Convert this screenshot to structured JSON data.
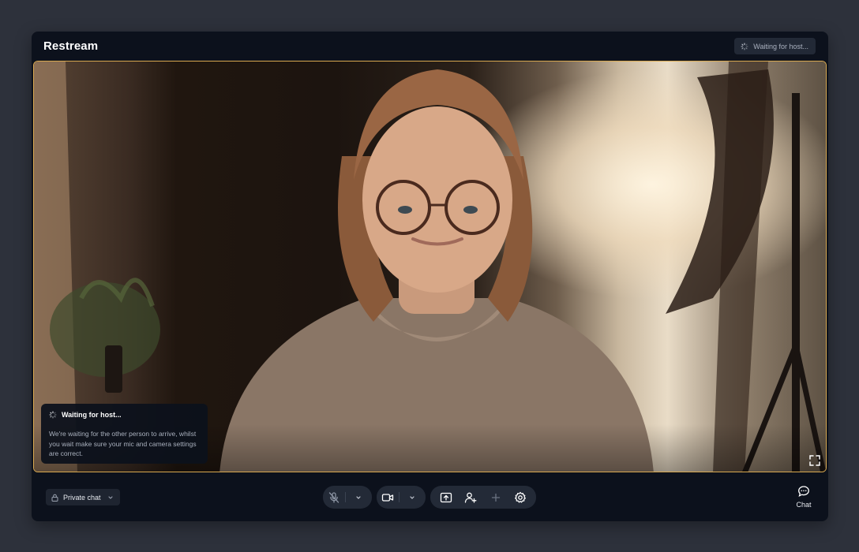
{
  "app": {
    "title": "Restream"
  },
  "header": {
    "status_text": "Waiting for host..."
  },
  "toast": {
    "title": "Waiting for host...",
    "message": "We're waiting for the other person to arrive, whilst you wait make sure your mic and camera settings are correct."
  },
  "controls": {
    "private_chat_label": "Private chat",
    "chat_label": "Chat",
    "mic_muted": true
  },
  "icons": {
    "status": "spinner-icon",
    "lock": "lock-icon",
    "mic": "mic-off-icon",
    "camera": "video-camera-icon",
    "share": "screen-share-icon",
    "invite": "add-person-icon",
    "add": "plus-icon",
    "settings": "settings-gear-icon",
    "fullscreen": "fullscreen-icon",
    "chat": "chat-bubble-icon"
  },
  "colors": {
    "accent_border": "#d9a950",
    "panel": "#0c111c",
    "background": "#2d313b",
    "control_pill": "#232a37"
  }
}
